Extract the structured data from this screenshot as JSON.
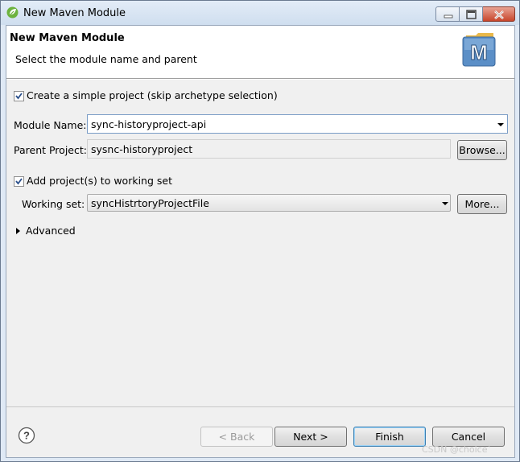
{
  "window": {
    "title": "New Maven Module"
  },
  "header": {
    "title": "New Maven Module",
    "subtitle": "Select the module name and parent",
    "badge_letter": "M"
  },
  "form": {
    "simple_project_label": "Create a simple project (skip archetype selection)",
    "simple_project_checked": true,
    "module_name_label": "Module Name:",
    "module_name_value": "sync-historyproject-api",
    "parent_project_label": "Parent Project:",
    "parent_project_value": "sysnc-historyproject",
    "browse_label": "Browse...",
    "working_set_checkbox_label": "Add project(s) to working set",
    "working_set_checked": true,
    "working_set_label": "Working set:",
    "working_set_value": "syncHistrtoryProjectFile",
    "more_label": "More...",
    "advanced_label": "Advanced"
  },
  "footer": {
    "help_glyph": "?",
    "back_label": "< Back",
    "next_label": "Next >",
    "finish_label": "Finish",
    "cancel_label": "Cancel"
  },
  "watermark": "CSDN @choice`",
  "colors": {
    "accent_border": "#7a9cc6",
    "default_button_border": "#3c7fb1",
    "close_button": "#c8462c"
  }
}
